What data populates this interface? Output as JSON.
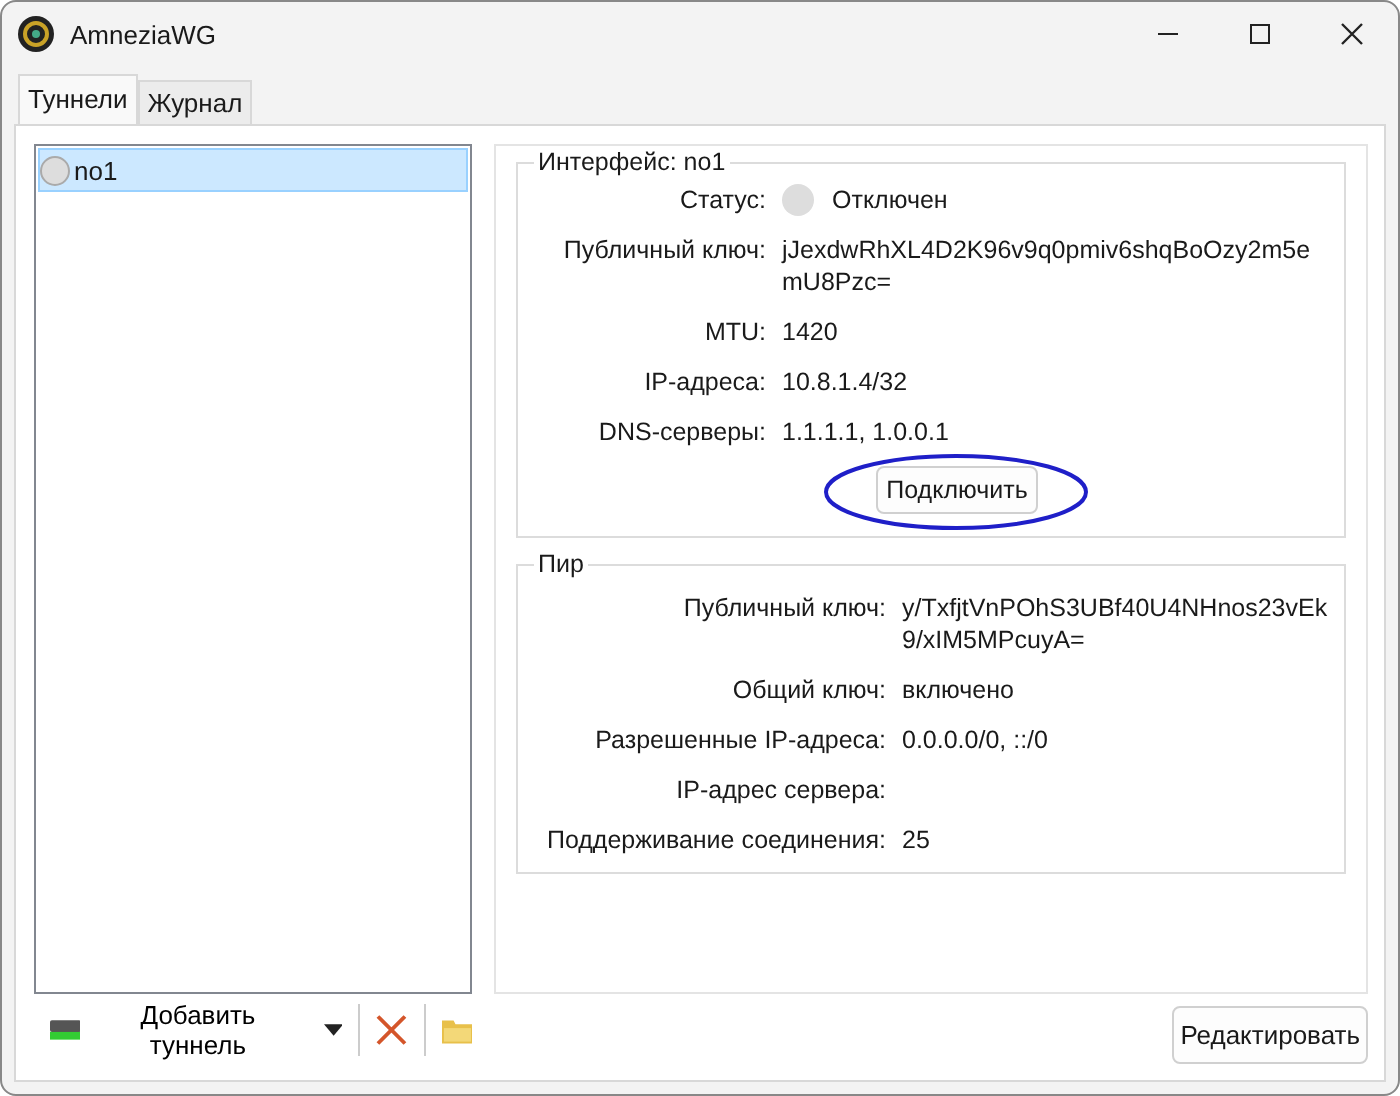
{
  "window": {
    "title": "AmneziaWG"
  },
  "tabs": [
    {
      "label": "Туннели",
      "selected": true
    },
    {
      "label": "Журнал",
      "selected": false
    }
  ],
  "tunnels": [
    {
      "name": "no1",
      "active": false,
      "selected": true
    }
  ],
  "interface": {
    "title": "Интерфейс: no1",
    "status": {
      "label": "Статус:",
      "value": "Отключен",
      "active": false
    },
    "rows": [
      {
        "label": "Публичный ключ:",
        "value": "jJexdwRhXL4D2K96v9q0pmiv6shqBoOzy2m5emU8Pzc="
      },
      {
        "label": "MTU:",
        "value": "1420"
      },
      {
        "label": "IP-адреса:",
        "value": "10.8.1.4/32"
      },
      {
        "label": "DNS-серверы:",
        "value": "1.1.1.1, 1.0.0.1"
      }
    ],
    "button": {
      "label": "Подключить",
      "circled": true
    }
  },
  "peer": {
    "title": "Пир",
    "rows": [
      {
        "label": "Публичный ключ:",
        "value": "y/TxfjtVnPOhS3UBf40U4NHnos23vEk9/xIM5MPcuyA="
      },
      {
        "label": "Общий ключ:",
        "value": "включено"
      },
      {
        "label": "Разрешенные IP-адреса:",
        "value": "0.0.0.0/0, ::/0"
      },
      {
        "label": "IP-адрес сервера:",
        "value": ""
      },
      {
        "label": "Поддерживание соединения:",
        "value": "25"
      }
    ]
  },
  "toolbar": {
    "add_label": "Добавить туннель"
  },
  "edit_button": "Редактировать"
}
